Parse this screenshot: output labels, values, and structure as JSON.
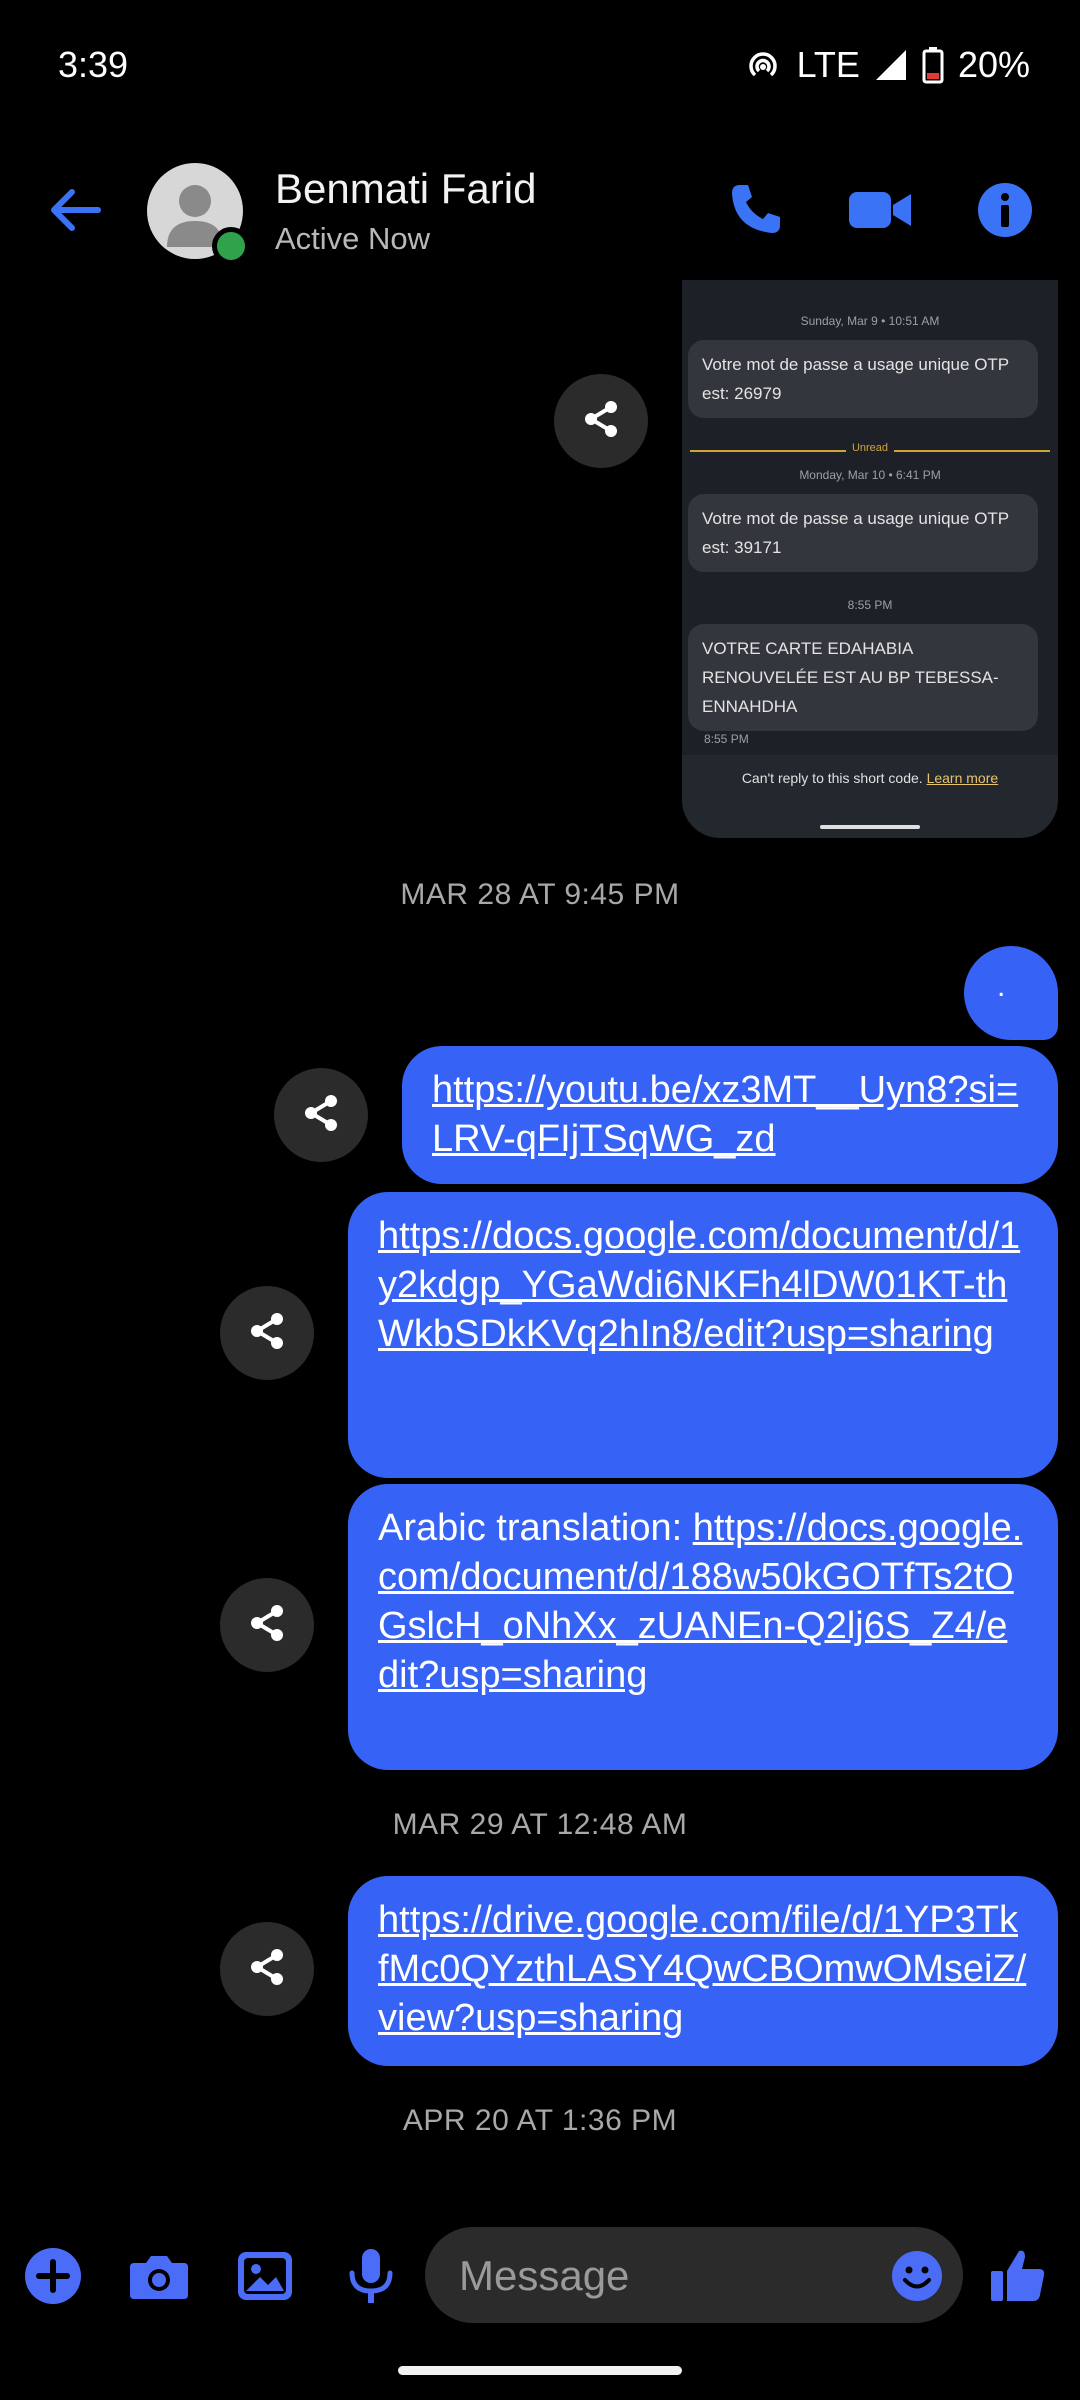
{
  "status_bar": {
    "time": "3:39",
    "network": "LTE",
    "battery": "20%"
  },
  "header": {
    "contact_name": "Benmati Farid",
    "contact_status": "Active Now",
    "accent_color": "#3a73f5"
  },
  "image_attachment": {
    "date_1": "Sunday, Mar 9 • 10:51 AM",
    "message_1": "Votre mot de passe a usage unique OTP est: 26979",
    "unread_label": "Unread",
    "date_2": "Monday, Mar 10 • 6:41 PM",
    "message_2": "Votre mot de passe a usage unique OTP est: 39171",
    "time_3": "8:55 PM",
    "message_3": "VOTRE CARTE EDAHABIA RENOUVELÉE EST AU BP TEBESSA-ENNAHDHA",
    "time_4": "8:55 PM",
    "footer_text": "Can't reply to this short code.",
    "footer_link": "Learn more"
  },
  "timestamps": {
    "t1": "MAR 28 AT 9:45 PM",
    "t2": "MAR 29 AT 12:48 AM",
    "t3": "APR 20 AT 1:36 PM"
  },
  "messages": {
    "dot": ".",
    "m1_link": "https://youtu.be/xz3MT__Uyn8?si=LRV-qFIjTSqWG_zd",
    "m2_link": "https://docs.google.com/document/d/1y2kdgp_YGaWdi6NKFh4lDW01KT-thWkbSDkKVq2hIn8/edit?usp=sharing",
    "m3_prefix": "Arabic translation: ",
    "m3_link": "https://docs.google.com/document/d/188w50kGOTfTs2tOGslcH_oNhXx_zUANEn-Q2lj6S_Z4/edit?usp=sharing",
    "m4_link": "https://drive.google.com/file/d/1YP3TkfMc0QYzthLASY4QwCBOmwOMseiZ/view?usp=sharing"
  },
  "composer": {
    "placeholder": "Message"
  },
  "colors": {
    "bubble": "#3663f5",
    "icon_accent": "#4a6cf7"
  }
}
